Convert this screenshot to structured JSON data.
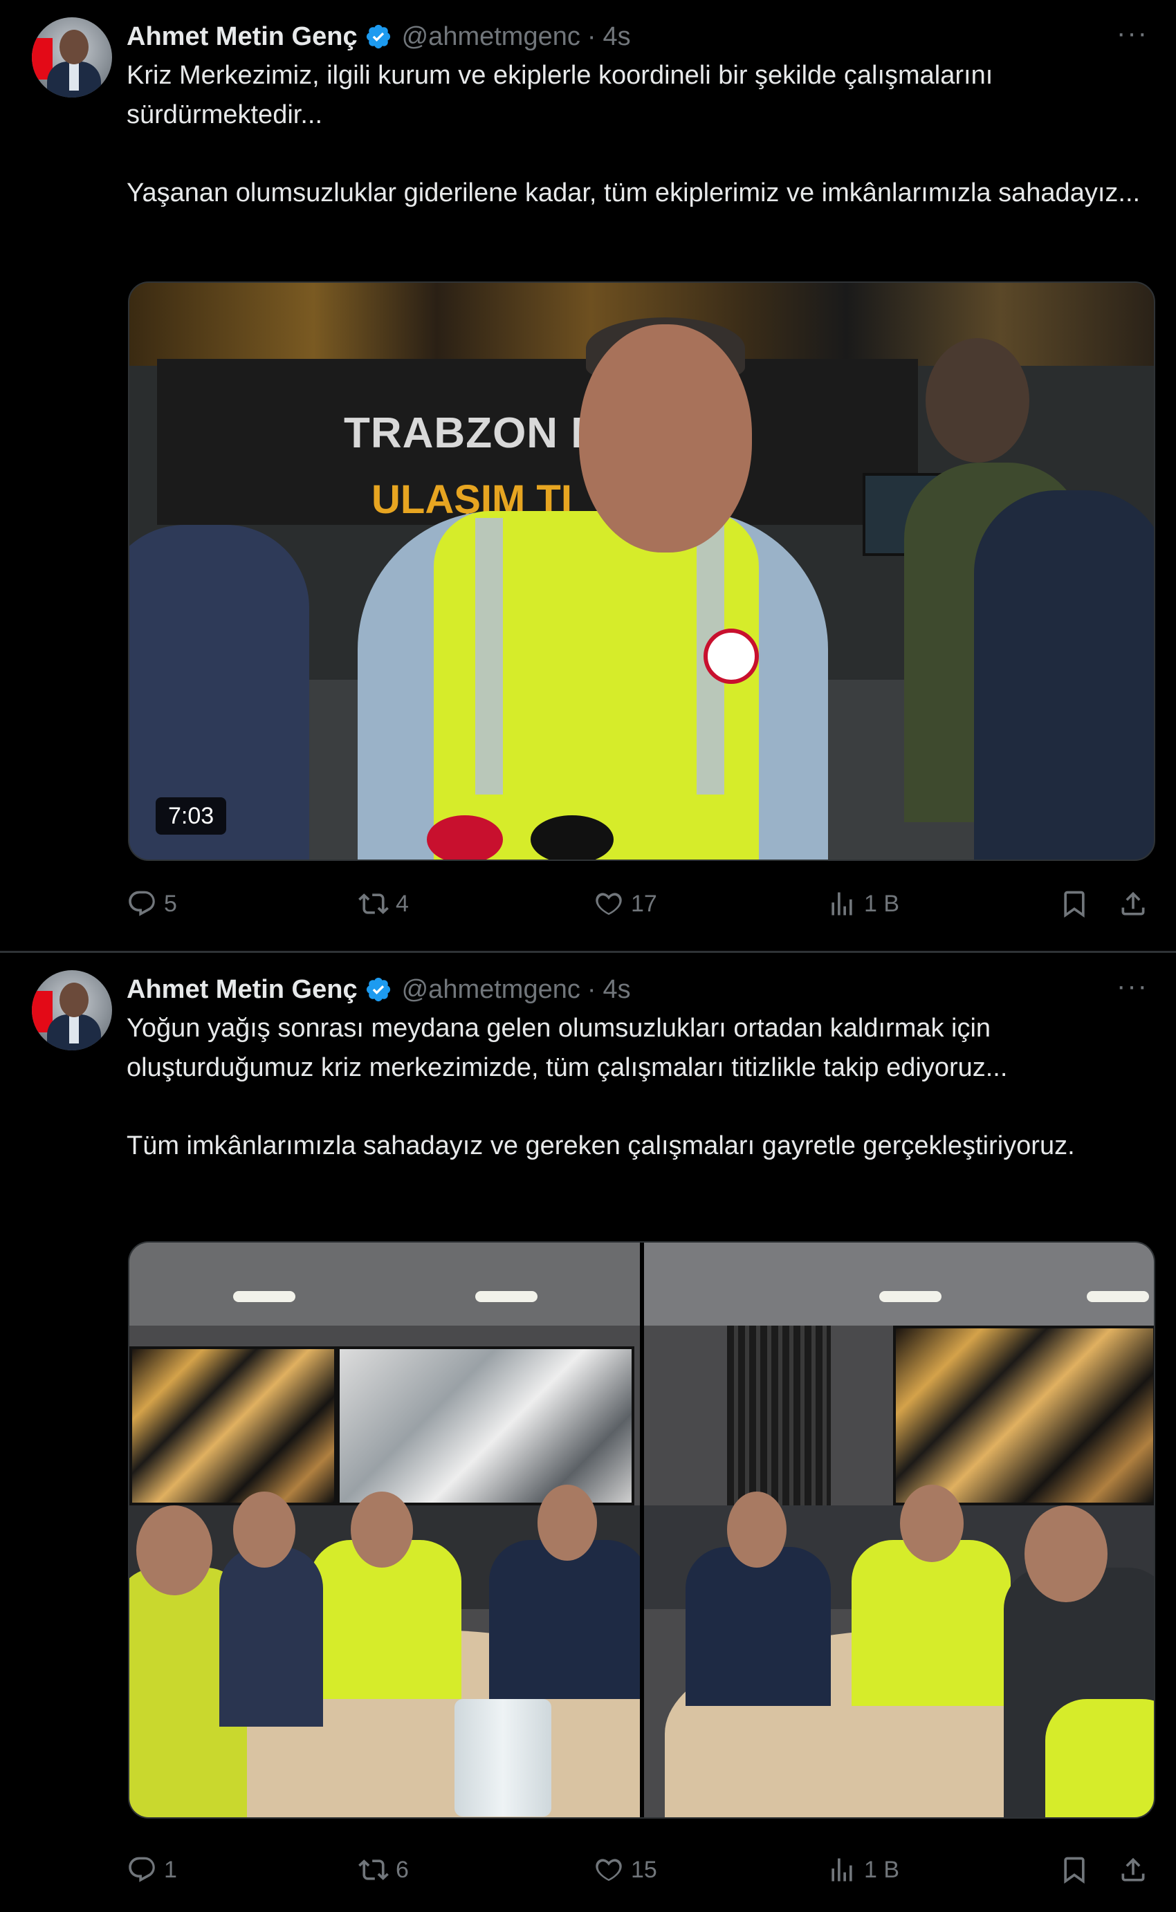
{
  "tweets": [
    {
      "author": {
        "name": "Ahmet Metin Genç",
        "handle": "@ahmetmgenc"
      },
      "separator": "·",
      "time": "4s",
      "paragraphs": [
        "Kriz Merkezimiz, ilgili kurum ve ekiplerle koordineli bir şekilde çalışmalarını sürdürmektedir...",
        "Yaşanan olumsuzluklar giderilene kadar, tüm ekiplerimiz ve imkânlarımızla sahadayız..."
      ],
      "video": {
        "board_line_1": "TRABZON B   ŞEH",
        "board_line_2": "ULAŞIM   TI",
        "duration": "7:03"
      },
      "stats": {
        "replies": "5",
        "retweets": "4",
        "likes": "17",
        "views": "1 B"
      }
    },
    {
      "author": {
        "name": "Ahmet Metin Genç",
        "handle": "@ahmetmgenc"
      },
      "separator": "·",
      "time": "4s",
      "paragraphs": [
        "Yoğun yağış sonrası meydana gelen olumsuzlukları ortadan kaldırmak için oluşturduğumuz kriz merkezimizde, tüm çalışmaları titizlikle takip ediyoruz...",
        "Tüm imkânlarımızla sahadayız ve gereken çalışmaları gayretle gerçekleştiriyoruz."
      ],
      "stats": {
        "replies": "1",
        "retweets": "6",
        "likes": "15",
        "views": "1 B"
      }
    }
  ],
  "icons": {
    "verified": "verified-badge-icon",
    "more": "more-options-icon",
    "reply": "reply-icon",
    "retweet": "retweet-icon",
    "like": "heart-icon",
    "views": "views-chart-icon",
    "bookmark": "bookmark-icon",
    "share": "share-icon"
  },
  "colors": {
    "background": "#000000",
    "text": "#e7e9ea",
    "muted": "#71767b",
    "verified": "#1d9bf0",
    "divider": "#2f3336"
  }
}
